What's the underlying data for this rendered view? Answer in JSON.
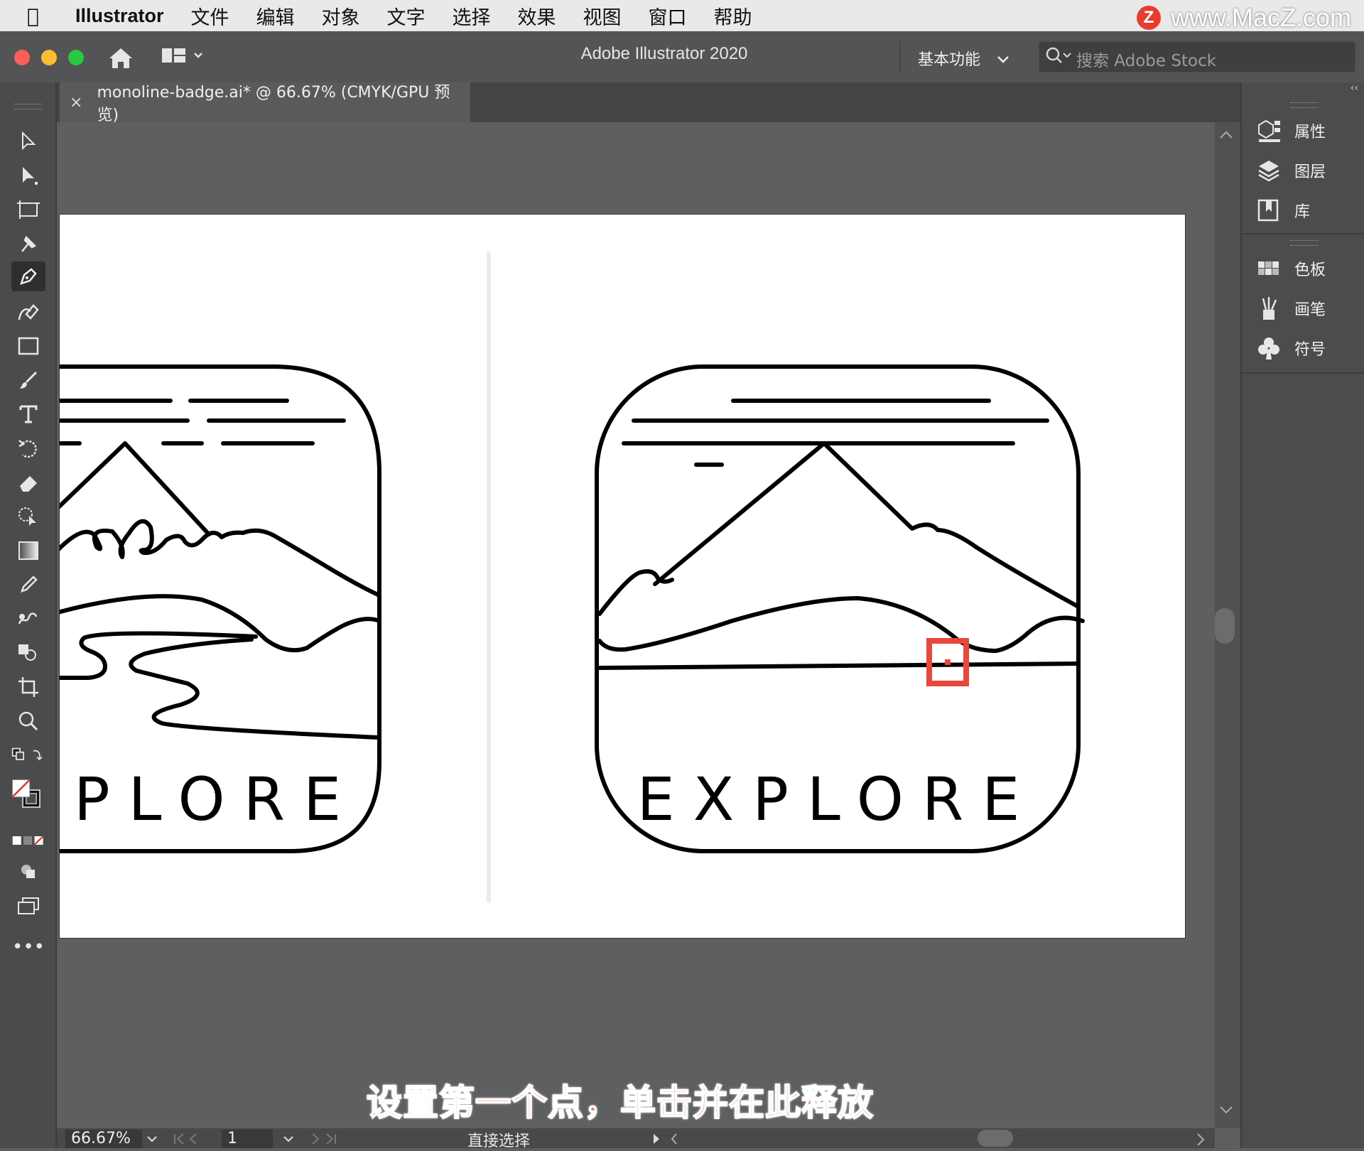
{
  "menubar": {
    "app_name": "Illustrator",
    "items": [
      "文件",
      "编辑",
      "对象",
      "文字",
      "选择",
      "效果",
      "视图",
      "窗口",
      "帮助"
    ]
  },
  "watermark": {
    "badge": "Z",
    "text": "www.MacZ.com"
  },
  "appbar": {
    "title": "Adobe Illustrator 2020",
    "workspace": "基本功能",
    "search_placeholder": "搜索 Adobe Stock"
  },
  "document_tab": {
    "close": "×",
    "label": "monoline-badge.ai* @ 66.67% (CMYK/GPU 预览)"
  },
  "artwork": {
    "left_badge_text": "PLORE",
    "right_badge_text": "EXPLORE"
  },
  "panels": {
    "group1": [
      "属性",
      "图层",
      "库"
    ],
    "group2": [
      "色板",
      "画笔",
      "符号"
    ]
  },
  "statusbar": {
    "zoom": "66.67%",
    "page": "1",
    "tool_name": "直接选择"
  },
  "subtitle": "设置第一个点，单击并在此释放",
  "colors": {
    "highlight": "#e8473a",
    "subtitle": "#ff5a4a"
  }
}
